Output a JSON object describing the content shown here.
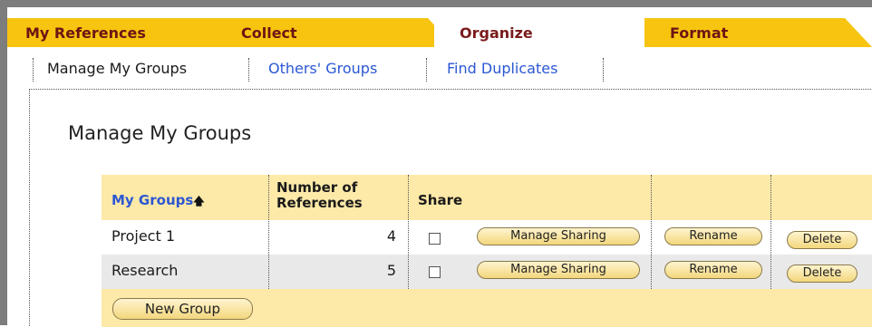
{
  "tabs": [
    {
      "label": "My References",
      "active": false
    },
    {
      "label": "Collect",
      "active": false
    },
    {
      "label": "Organize",
      "active": true
    },
    {
      "label": "Format",
      "active": false
    }
  ],
  "subnav": [
    {
      "label": "Manage My Groups",
      "current": true
    },
    {
      "label": "Others' Groups",
      "current": false
    },
    {
      "label": "Find Duplicates",
      "current": false
    }
  ],
  "page": {
    "title": "Manage My Groups"
  },
  "table": {
    "headers": {
      "groups": "My Groups",
      "sort_icon": "arrow-up-icon",
      "num_refs": "Number of References",
      "share": "Share"
    },
    "rows": [
      {
        "name": "Project 1",
        "count": "4",
        "shared": false,
        "manage_label": "Manage Sharing",
        "rename_label": "Rename",
        "delete_label": "Delete"
      },
      {
        "name": "Research",
        "count": "5",
        "shared": false,
        "manage_label": "Manage Sharing",
        "rename_label": "Rename",
        "delete_label": "Delete"
      }
    ],
    "new_group_label": "New Group"
  },
  "colors": {
    "tab_bg": "#f7c410",
    "tab_text": "#6e1414",
    "link": "#2b57d3",
    "table_bg": "#fde9a8",
    "button_border": "#8a7a4a"
  }
}
